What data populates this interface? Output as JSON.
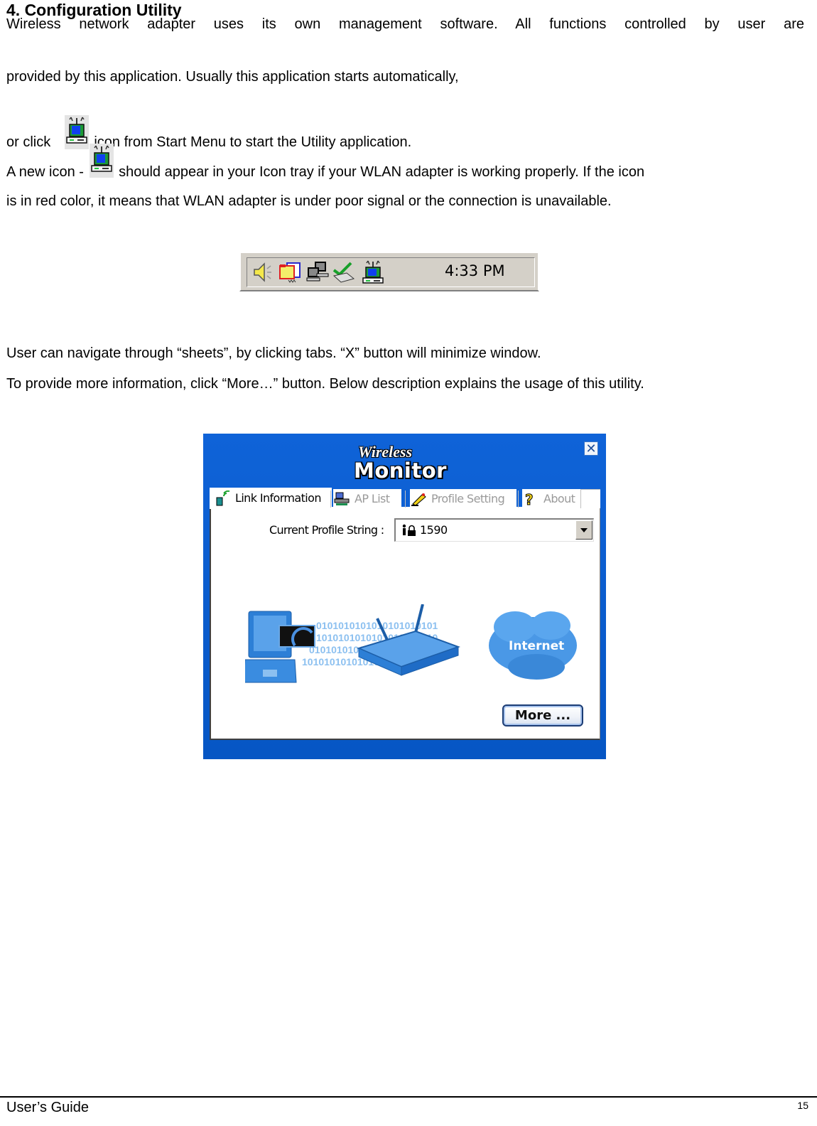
{
  "document": {
    "heading": "4. Configuration Utility",
    "para1_line1": "Wireless network adapter uses its own management software. All functions controlled by user are",
    "para1_line2": "provided by this application. Usually this application starts automatically,",
    "para2_before_icon": "or click",
    "para2_after_icon": "icon from Start Menu to start the Utility application.",
    "para3_before_icon": "A new icon -",
    "para3_after_icon": "should appear in your Icon tray if your WLAN adapter is working properly. If the icon",
    "para3_line2": "is in red color, it means that WLAN adapter is under poor signal or the connection is unavailable.",
    "para4_line1": "User can navigate through “sheets”, by clicking tabs.  “X” button will minimize window.",
    "para4_line2": "To provide more information, click “More…” button. Below description explains the usage of this utility.",
    "inline_icon": "wlan-utility-icon"
  },
  "tray": {
    "icons": [
      "speaker-icon",
      "display-icon",
      "network-computers-icon",
      "safely-remove-hardware-icon",
      "wlan-utility-icon"
    ],
    "clock": "4:33 PM"
  },
  "app": {
    "logo_top": "Wireless",
    "logo_main": "Monitor",
    "close_label": "✕",
    "tabs": [
      {
        "label": "Link Information",
        "icon": "link-signal-icon",
        "active": true
      },
      {
        "label": "AP List",
        "icon": "ap-list-icon",
        "active": false
      },
      {
        "label": "Profile Setting",
        "icon": "profile-pencil-icon",
        "active": false
      },
      {
        "label": "About",
        "icon": "question-icon",
        "active": false
      }
    ],
    "profile_label": "Current Profile String :",
    "profile_value": "1590",
    "illustration_label": "Internet",
    "binary_rows": [
      "0101010101010101010101",
      "1010101010101010101010",
      "0101010101010101010101",
      "1010101010101010101010"
    ],
    "more_button": "More ..."
  },
  "footer": {
    "title": "User’s Guide",
    "page_number": "15"
  },
  "colors": {
    "window_blue": "#0a5fd0",
    "tray_gray": "#d4d0c8",
    "illustration_blue": "#2a7fd8"
  }
}
